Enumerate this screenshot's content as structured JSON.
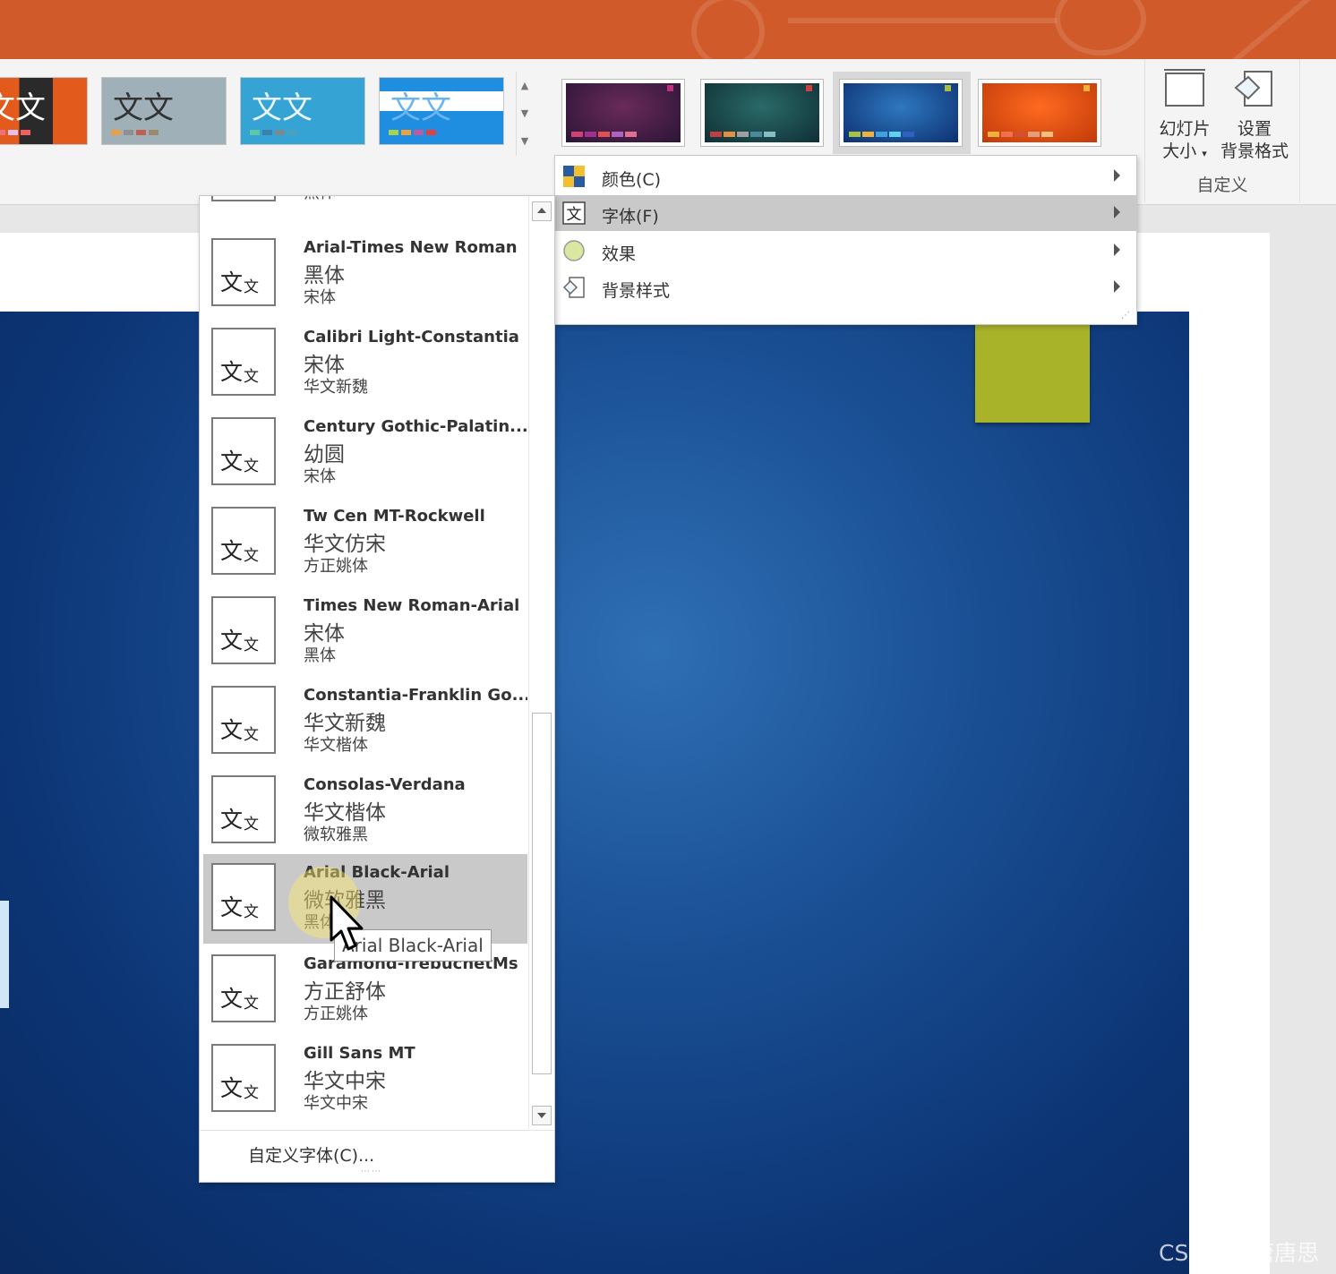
{
  "ribbon": {
    "themes": [
      {
        "text": "文文"
      },
      {
        "text": "文文"
      },
      {
        "text": "文文"
      },
      {
        "text": "文文"
      }
    ],
    "custom_group": {
      "slide_size_label_1": "幻灯片",
      "slide_size_label_2": "大小",
      "format_bg_label_1": "设置",
      "format_bg_label_2": "背景格式",
      "group_label": "自定义"
    }
  },
  "variant_menu": {
    "items": [
      {
        "label": "颜色(C)",
        "icon": "color-palette-icon"
      },
      {
        "label": "字体(F)",
        "icon": "font-icon",
        "active": true
      },
      {
        "label": "效果",
        "icon": "effects-icon"
      },
      {
        "label": "背景样式",
        "icon": "background-style-icon"
      }
    ]
  },
  "fonts_dropdown": {
    "partial_top_minor": "黑体",
    "items": [
      {
        "name": "Arial-Times New Roman",
        "major": "黑体",
        "minor": "宋体"
      },
      {
        "name": "Calibri Light-Constantia",
        "major": "宋体",
        "minor": "华文新魏"
      },
      {
        "name": "Century Gothic-Palatin...",
        "major": "幼圆",
        "minor": "宋体"
      },
      {
        "name": "Tw Cen MT-Rockwell",
        "major": "华文仿宋",
        "minor": "方正姚体"
      },
      {
        "name": "Times New Roman-Arial",
        "major": "宋体",
        "minor": "黑体"
      },
      {
        "name": "Constantia-Franklin Go...",
        "major": "华文新魏",
        "minor": "华文楷体"
      },
      {
        "name": "Consolas-Verdana",
        "major": "华文楷体",
        "minor": "微软雅黑"
      },
      {
        "name": "Arial Black-Arial",
        "major": "微软雅黑",
        "minor": "黑体",
        "hover": true
      },
      {
        "name": "Garamond-TrebuchetMs",
        "major": "方正舒体",
        "minor": "方正姚体"
      },
      {
        "name": "Gill Sans MT",
        "major": "华文中宋",
        "minor": "华文中宋"
      }
    ],
    "thumb_text_a": "文",
    "thumb_text_b": "文",
    "custom_fonts_label": "自定义字体(C)..."
  },
  "tooltip": "Arial Black-Arial",
  "watermark": "CSDN @唐唐思",
  "colors": {
    "title_bar": "#d05a2a",
    "slide_accent_green": "#a8b32a",
    "slide_blue": "#1a4f94"
  }
}
